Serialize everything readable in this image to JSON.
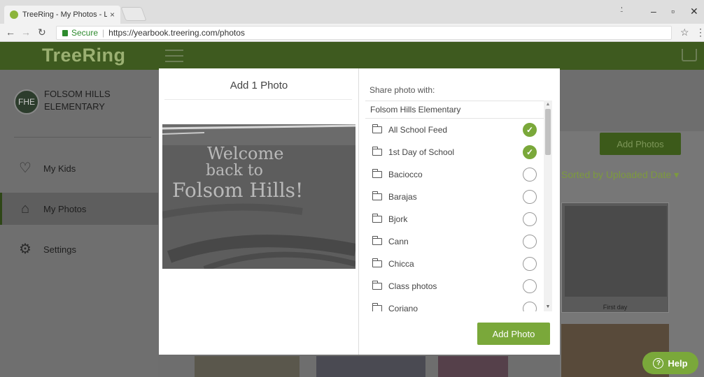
{
  "browser": {
    "tab_title": "TreeRing - My Photos - L",
    "tab_close": "×",
    "secure_label": "Secure",
    "url": "https://yearbook.treering.com/photos",
    "icons": [
      "back-icon",
      "forward-icon",
      "reload-icon",
      "star-icon",
      "menu-icon",
      "minimize-icon",
      "maximize-icon",
      "close-icon"
    ]
  },
  "header": {
    "logo": "TreeRing",
    "brand_color": "#3e5a1f"
  },
  "sidebar": {
    "avatar_initials": "FHE",
    "school_name": "FOLSOM HILLS ELEMENTARY",
    "items": [
      {
        "label": "My Kids",
        "icon": "heart-icon"
      },
      {
        "label": "My Photos",
        "icon": "camera-icon",
        "active": true
      },
      {
        "label": "Settings",
        "icon": "gear-icon"
      }
    ]
  },
  "background": {
    "add_photos_label": "Add Photos",
    "sort_label": "Sorted by Uploaded Date ▾",
    "thumb_caption": "First day"
  },
  "modal": {
    "title": "Add 1 Photo",
    "photo_text": [
      "Welcome",
      "back to",
      "Folsom Hills!"
    ],
    "share_label": "Share photo with:",
    "school": "Folsom Hills Elementary",
    "folders": [
      {
        "label": "All School Feed",
        "checked": true
      },
      {
        "label": "1st Day of School",
        "checked": true
      },
      {
        "label": "Baciocco",
        "checked": false
      },
      {
        "label": "Barajas",
        "checked": false
      },
      {
        "label": "Bjork",
        "checked": false
      },
      {
        "label": "Cann",
        "checked": false
      },
      {
        "label": "Chicca",
        "checked": false
      },
      {
        "label": "Class photos",
        "checked": false
      },
      {
        "label": "Coriano",
        "checked": false
      }
    ],
    "add_button": "Add Photo",
    "accent_color": "#7aa83a"
  },
  "help": {
    "label": "Help"
  }
}
